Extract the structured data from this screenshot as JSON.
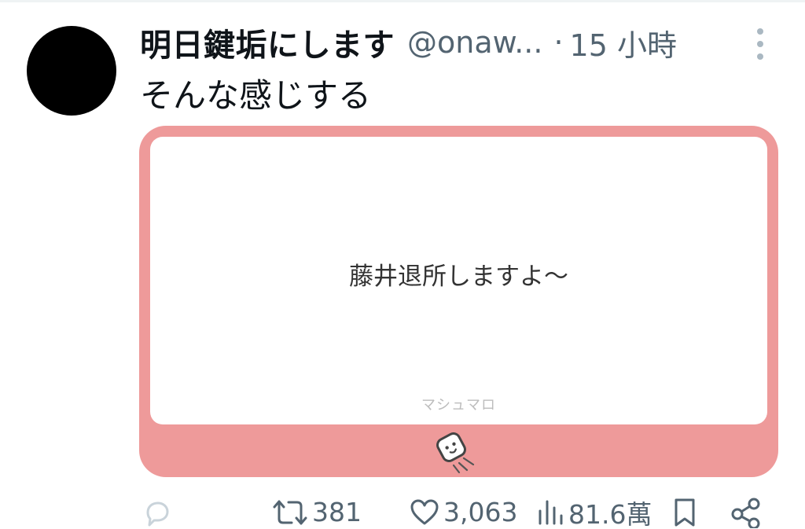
{
  "tweet": {
    "display_name": "明日鍵垢にします",
    "handle": "@onaw...",
    "separator": "·",
    "time": "15 小時",
    "text": "そんな感じする"
  },
  "card": {
    "question": "藤井退所しますよ〜",
    "brand": "マシュマロ",
    "border_color": "#ee9a9a"
  },
  "actions": {
    "retweets": "381",
    "likes": "3,063",
    "views": "81.6萬"
  },
  "icons": [
    "avatar",
    "more-icon",
    "reply-icon",
    "retweet-icon",
    "like-icon",
    "views-icon",
    "bookmark-icon",
    "share-icon",
    "marshmallow-mascot-icon"
  ]
}
